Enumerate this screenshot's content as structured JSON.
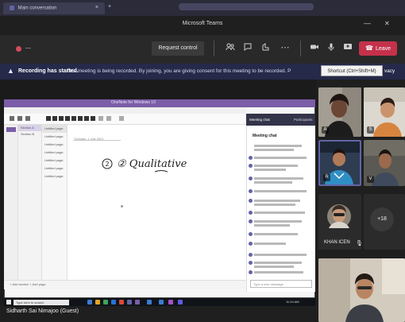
{
  "browser": {
    "tab_label": "Main conversation",
    "tab_close": "×",
    "new_tab": "+"
  },
  "window": {
    "title": "Microsoft Teams",
    "minimize": "—",
    "close": "✕"
  },
  "toolbar": {
    "recording_time": "—",
    "request_control": "Request control",
    "icons": [
      "people-icon",
      "chat-icon",
      "reactions-icon",
      "more-icon",
      "camera-icon",
      "mic-icon",
      "share-icon"
    ],
    "leave": "Leave"
  },
  "banner": {
    "title": "Recording has started.",
    "text": "This meeting is being recorded. By joining, you are giving consent for this meeting to be recorded. P",
    "tooltip": "Shortcut (Ctrl+Shift+M)",
    "more": "vacy"
  },
  "shared_screen": {
    "onenote_title": "OneNote for Windows 10",
    "sections": [
      "Notebook 1",
      "Section A",
      "Section B"
    ],
    "pages": [
      "Untitled page",
      "Untitled page",
      "Untitled page",
      "Untitled page",
      "Untitled page",
      "Untitled page",
      "Untitled page",
      "Untitled page"
    ],
    "date_text": "Tuesday, 1 July 2021",
    "ink_text": "② Qualitative Labs",
    "status": "+ Add section     + Add page",
    "chat_tab": "Meeting chat",
    "chat_tab_right": "Participants",
    "chat_heading": "Meeting chat",
    "chat_input": "Type a new message",
    "taskbar_search": "Type here to search",
    "taskbar_clock": "11:24 AM"
  },
  "presenter_name": "Sidharth Sai Nimajoo (Guest)",
  "participants": {
    "tile1_initial": "A",
    "tile2_initial": "S",
    "tile3_initial": "R",
    "tile4_initial": "V",
    "more_count": "+18",
    "tile5_name": "KHAN ICEN"
  }
}
